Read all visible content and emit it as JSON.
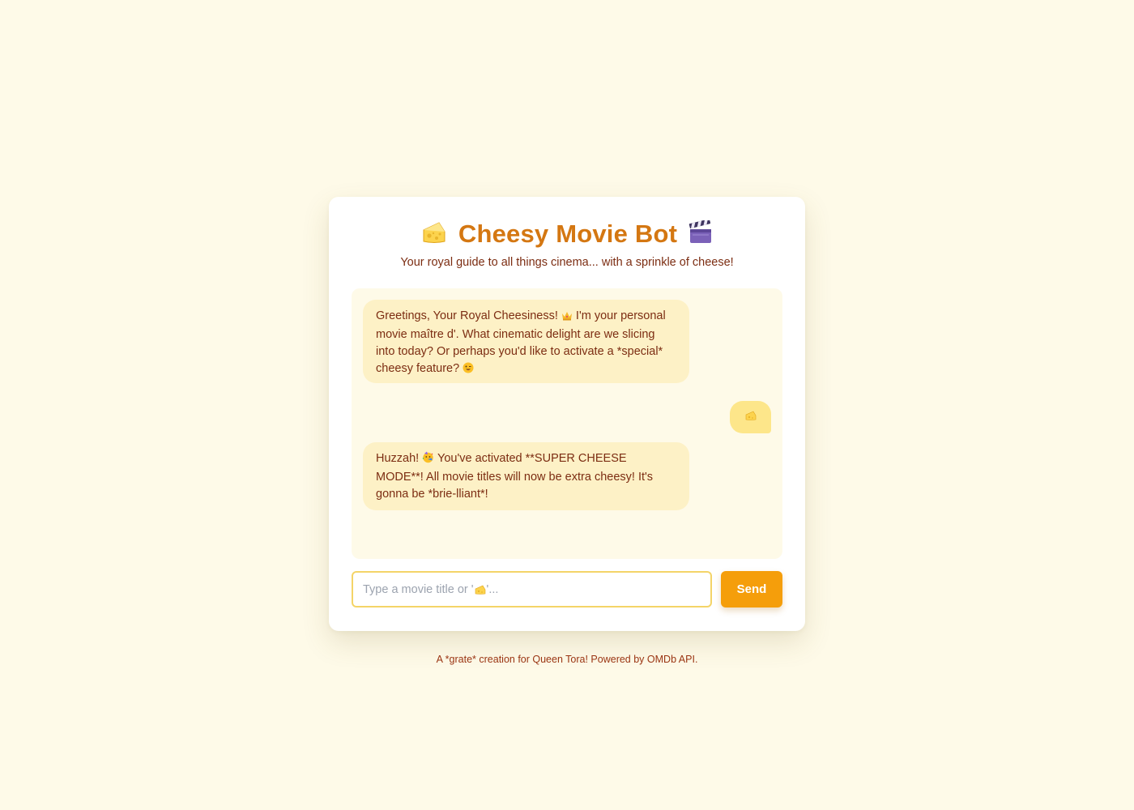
{
  "header": {
    "title": "Cheesy Movie Bot",
    "title_icon_left": "cheese-icon",
    "title_icon_right": "clapper-board-icon",
    "subtitle": "Your royal guide to all things cinema... with a sprinkle of cheese!"
  },
  "chat": {
    "messages": [
      {
        "role": "bot",
        "parts": {
          "a": "Greetings, Your Royal Cheesiness! ",
          "b": " I'm your personal movie maître d'. What cinematic delight are we slicing into today? Or perhaps you'd like to activate a *special* cheesy feature? "
        },
        "icons": [
          "crown-icon",
          "winking-face-icon"
        ]
      },
      {
        "role": "user",
        "icon": "cheese-icon"
      },
      {
        "role": "bot",
        "parts": {
          "a": "Huzzah! ",
          "b": " You've activated **SUPER CHEESE MODE**! All movie titles will now be extra cheesy! It's gonna be *brie-lliant*!"
        },
        "icons": [
          "party-face-icon"
        ]
      }
    ]
  },
  "input": {
    "placeholder_before": "Type a movie title or '",
    "placeholder_after": "'...",
    "placeholder_icon": "cheese-icon"
  },
  "send_button": {
    "label": "Send"
  },
  "footer": {
    "text": "A *grate* creation for Queen Tora! Powered by OMDb API."
  },
  "colors": {
    "background": "#fefae8",
    "title": "#d47712",
    "text": "#7c2d12",
    "bot_bubble": "#fdf1c6",
    "user_bubble": "#fde68a",
    "send_button": "#f59e0b",
    "input_border": "#f4d468"
  }
}
